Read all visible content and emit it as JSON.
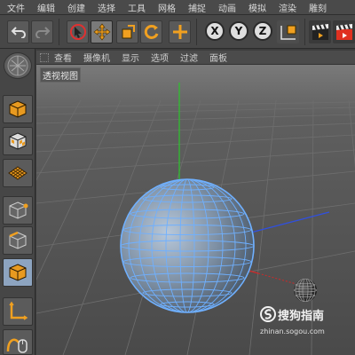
{
  "menubar": {
    "items": [
      "文件",
      "编辑",
      "创建",
      "选择",
      "工具",
      "网格",
      "捕捉",
      "动画",
      "模拟",
      "渲染",
      "雕刻"
    ]
  },
  "toolbar": {
    "axis_x": "X",
    "axis_y": "Y",
    "axis_z": "Z"
  },
  "viewport_menu": {
    "items": [
      "查看",
      "摄像机",
      "显示",
      "选项",
      "过滤",
      "面板"
    ]
  },
  "viewport": {
    "label": "透视视图"
  },
  "watermark": {
    "brand": "搜狗指南",
    "url": "zhinan.sogou.com"
  },
  "colors": {
    "accent_orange": "#f0a020",
    "sphere_wire": "#6fb0ff",
    "y_axis": "#2fbf2f",
    "x_axis": "#d02828",
    "z_axis": "#3050e0",
    "active_tool": "#8da4c0"
  }
}
